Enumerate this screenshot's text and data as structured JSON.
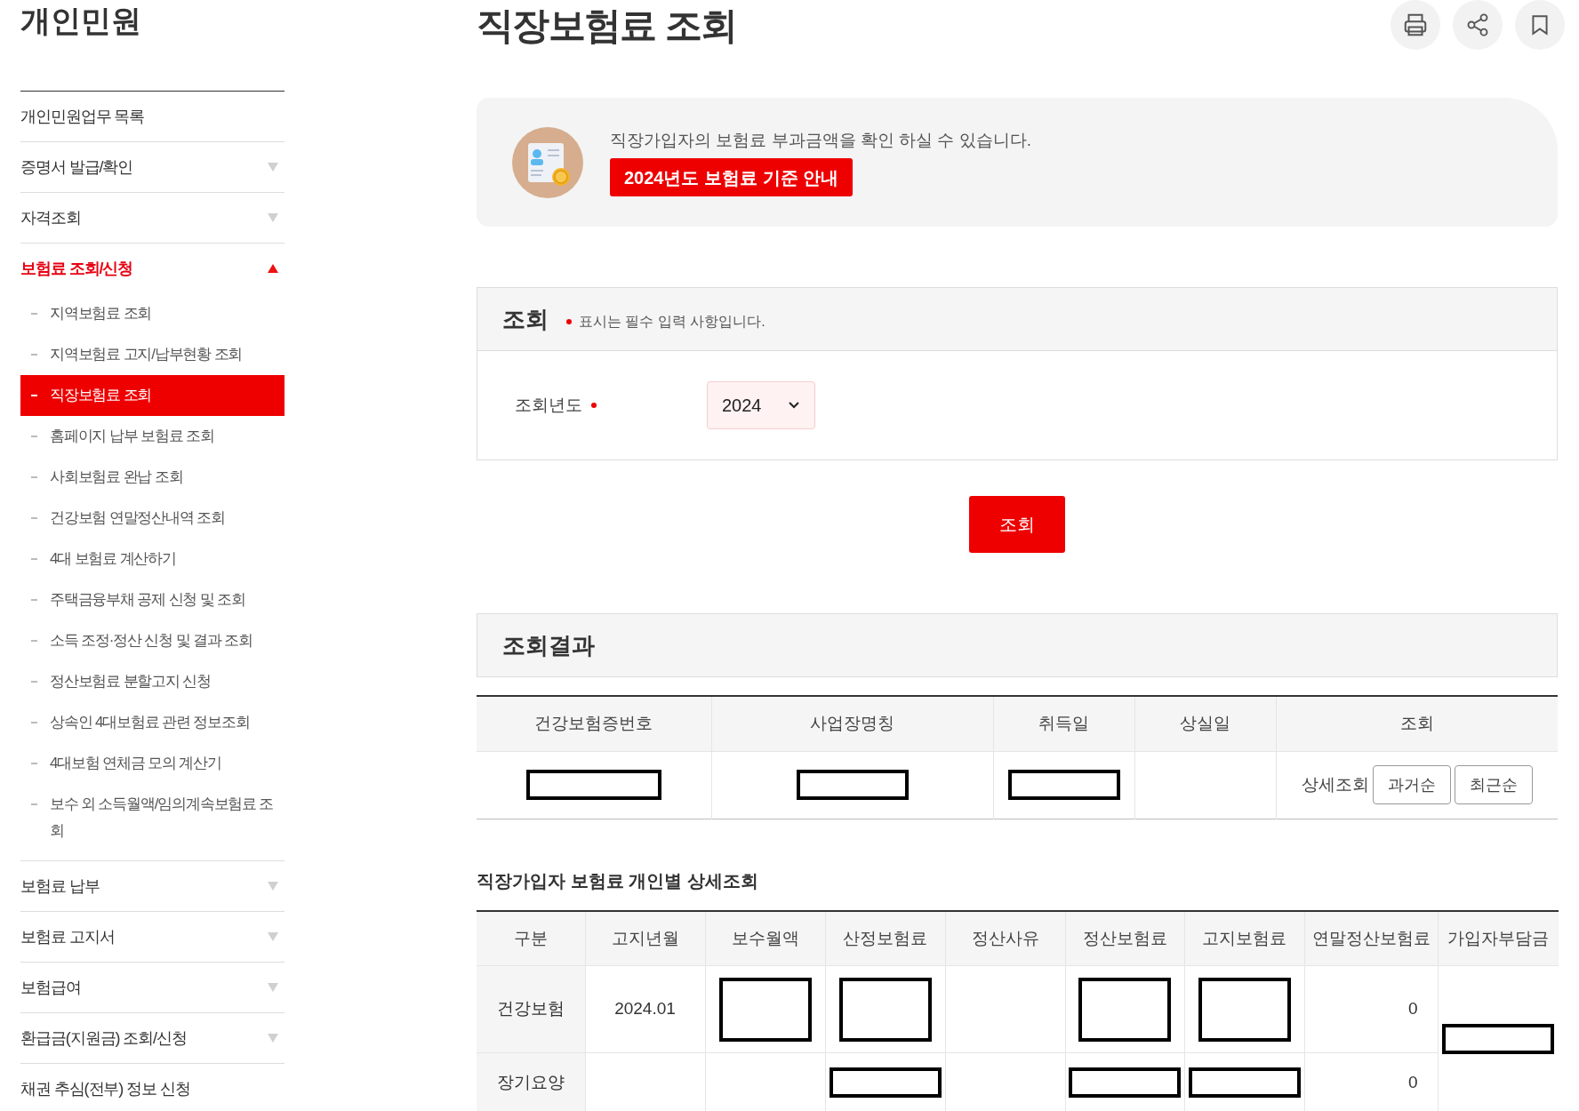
{
  "sidebar": {
    "title": "개인민원",
    "items": [
      {
        "label": "개인민원업무 목록",
        "kind": "link"
      },
      {
        "label": "증명서 발급/확인",
        "kind": "group",
        "expanded": false
      },
      {
        "label": "자격조회",
        "kind": "group",
        "expanded": false
      },
      {
        "label": "보험료 조회/신청",
        "kind": "group",
        "expanded": true,
        "children": [
          {
            "label": "지역보험료 조회",
            "selected": false
          },
          {
            "label": "지역보험료 고지/납부현황 조회",
            "selected": false
          },
          {
            "label": "직장보험료 조회",
            "selected": true
          },
          {
            "label": "홈페이지 납부 보험료 조회",
            "selected": false
          },
          {
            "label": "사회보험료 완납 조회",
            "selected": false
          },
          {
            "label": "건강보험 연말정산내역 조회",
            "selected": false
          },
          {
            "label": "4대 보험료 계산하기",
            "selected": false
          },
          {
            "label": "주택금융부채 공제 신청 및 조회",
            "selected": false
          },
          {
            "label": "소득 조정·정산 신청 및 결과 조회",
            "selected": false
          },
          {
            "label": "정산보험료 분할고지 신청",
            "selected": false
          },
          {
            "label": "상속인 4대보험료 관련 정보조회",
            "selected": false
          },
          {
            "label": "4대보험 연체금 모의 계산기",
            "selected": false
          },
          {
            "label": "보수 외 소득월액/임의계속보험료 조회",
            "selected": false
          }
        ]
      },
      {
        "label": "보험료 납부",
        "kind": "group",
        "expanded": false
      },
      {
        "label": "보험료 고지서",
        "kind": "group",
        "expanded": false
      },
      {
        "label": "보험급여",
        "kind": "group",
        "expanded": false
      },
      {
        "label": "환급금(지원금) 조회/신청",
        "kind": "group",
        "expanded": false
      },
      {
        "label": "채권 추심(전부) 정보 신청",
        "kind": "link"
      }
    ]
  },
  "page": {
    "title": "직장보험료 조회"
  },
  "banner": {
    "text": "직장가입자의 보험료 부과금액을 확인 하실 수 있습니다.",
    "button": "2024년도 보험료 기준 안내"
  },
  "query": {
    "title": "조회",
    "note": "표시는 필수 입력 사항입니다.",
    "field_label": "조회년도",
    "year": "2024",
    "button": "조회"
  },
  "result": {
    "title": "조회결과",
    "columns": [
      "건강보험증번호",
      "사업장명칭",
      "취득일",
      "상실일",
      "조회"
    ],
    "row": {
      "cells": [
        {
          "kind": "redacted"
        },
        {
          "kind": "redacted"
        },
        {
          "kind": "redacted"
        },
        {
          "kind": "empty"
        }
      ],
      "detail_label": "상세조회",
      "buttons": [
        "과거순",
        "최근순"
      ]
    }
  },
  "detail": {
    "title": "직장가입자 보험료 개인별 상세조회",
    "columns": [
      "구분",
      "고지년월",
      "보수월액",
      "산정보험료",
      "정산사유",
      "정산보험료",
      "고지보험료",
      "연말정산보험료",
      "가입자부담금"
    ],
    "rows": [
      {
        "cells": [
          {
            "kind": "text",
            "text": "건강보험"
          },
          {
            "kind": "text",
            "text": "2024.01"
          },
          {
            "kind": "redacted"
          },
          {
            "kind": "redacted"
          },
          {
            "kind": "empty"
          },
          {
            "kind": "redacted"
          },
          {
            "kind": "redacted"
          },
          {
            "kind": "number",
            "text": "0"
          }
        ]
      },
      {
        "cells": [
          {
            "kind": "text",
            "text": "장기요양"
          },
          {
            "kind": "empty"
          },
          {
            "kind": "empty"
          },
          {
            "kind": "redacted"
          },
          {
            "kind": "empty"
          },
          {
            "kind": "redacted"
          },
          {
            "kind": "redacted"
          },
          {
            "kind": "number",
            "text": "0"
          }
        ]
      }
    ],
    "total_cell": {
      "kind": "redacted"
    }
  }
}
